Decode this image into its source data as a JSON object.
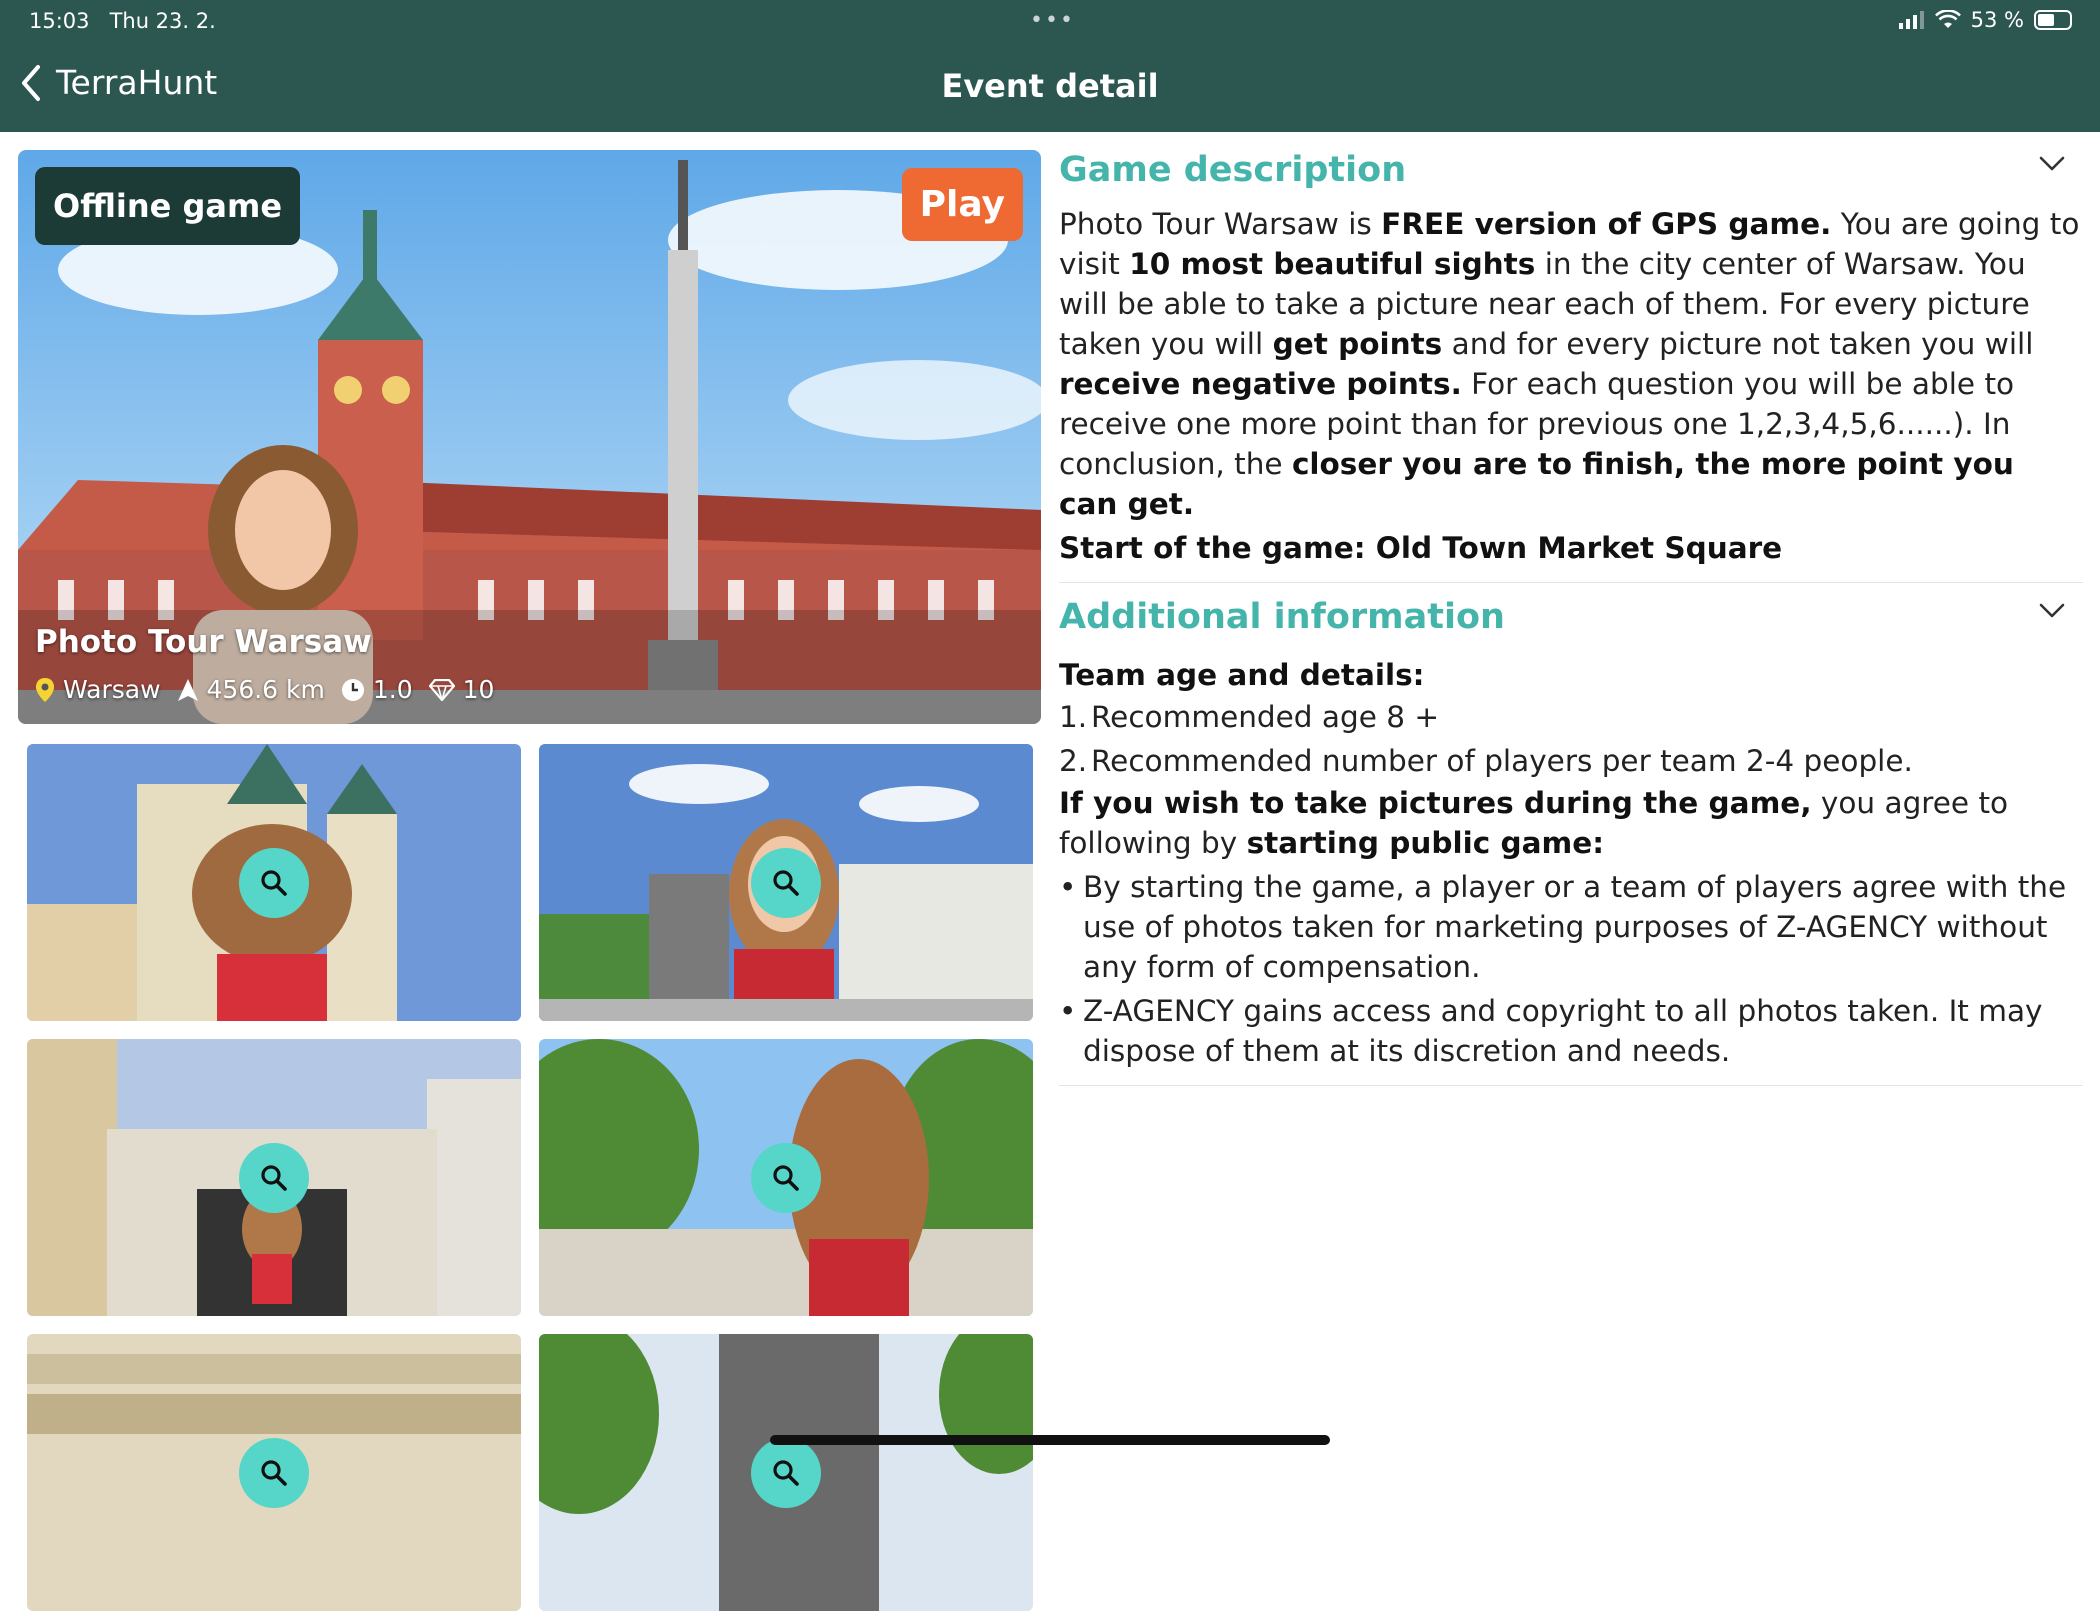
{
  "status": {
    "time": "15:03",
    "date": "Thu 23. 2.",
    "battery": "53 %",
    "battery_level": 0.53
  },
  "nav": {
    "back_label": "TerraHunt",
    "title": "Event detail"
  },
  "hero": {
    "badge": "Offline game",
    "play_label": "Play",
    "title": "Photo Tour Warsaw",
    "location": "Warsaw",
    "distance": "456.6 km",
    "duration": "1.0",
    "points": "10"
  },
  "thumbnails_count": 6,
  "description": {
    "title": "Game description",
    "p1_a": "Photo Tour Warsaw is ",
    "p1_b": "FREE version of GPS game.",
    "p1_c": " You are going to visit ",
    "p1_d": "10 most beautiful sights",
    "p1_e": " in the city center of Warsaw. You will be able to take a picture near each of them. For every picture taken you will ",
    "p1_f": "get points",
    "p1_g": " and for every picture not taken you will ",
    "p1_h": "receive negative points.",
    "p1_i": " For each question you will be able to receive one more point than for previous one 1,2,3,4,5,6......). In conclusion, the ",
    "p1_j": "closer you are to finish, the more point you can get.",
    "start": "Start of the game: Old Town Market Square"
  },
  "additional": {
    "title": "Additional information",
    "team_heading": "Team age and details:",
    "items": [
      {
        "n": "1.",
        "text": "Recommended age 8 +"
      },
      {
        "n": "2.",
        "text": "Recommended number of players per team 2-4 people."
      }
    ],
    "photo_a": "If you wish to take pictures during the game,",
    "photo_b": " you agree to following by ",
    "photo_c": "starting public game:",
    "bullets": [
      "By starting the game, a player or a team of players agree with the use of photos taken for marketing purposes of Z-AGENCY without any form of compensation.",
      "Z-AGENCY gains access and copyright to all photos taken. It may dispose of them at its discretion and needs."
    ]
  },
  "colors": {
    "header": "#2c5650",
    "accent": "#45b5ac",
    "play": "#ef6a32",
    "zoom": "#55d6c8"
  }
}
